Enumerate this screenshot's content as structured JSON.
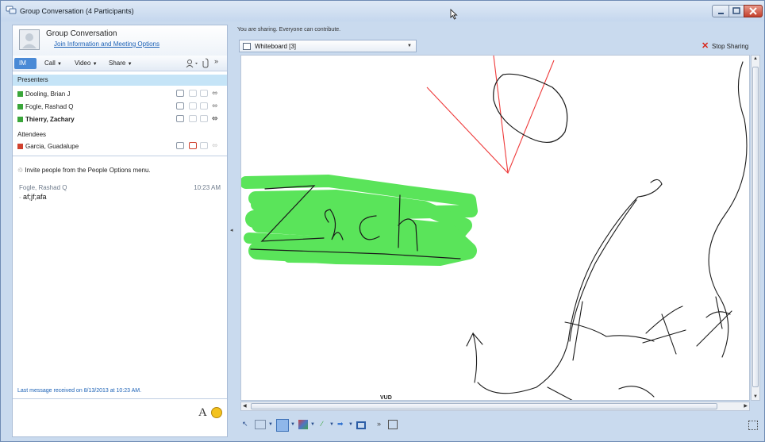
{
  "window": {
    "title": "Group Conversation (4 Participants)"
  },
  "contact": {
    "name": "Group Conversation",
    "link": "Join Information and Meeting Options"
  },
  "tabs": {
    "im": "IM",
    "call": "Call",
    "video": "Video",
    "share": "Share"
  },
  "participants": {
    "presenters_label": "Presenters",
    "attendees_label": "Attendees",
    "presenters": [
      {
        "name": "Dooling, Brian J",
        "status_color": "#3aa63a"
      },
      {
        "name": "Fogle, Rashad Q",
        "status_color": "#3aa63a"
      },
      {
        "name": "Thierry, Zachary",
        "status_color": "#3aa63a"
      }
    ],
    "attendees": [
      {
        "name": "Garcia, Guadalupe",
        "status_color": "#d0412e"
      }
    ]
  },
  "chat": {
    "invite_text": "Invite people from the People Options menu.",
    "author": "Fogle, Rashad Q",
    "time": "10:23 AM",
    "message": "af;jf;afa",
    "last_message": "Last message received on 8/13/2013 at 10:23 AM."
  },
  "compose": {
    "font_label": "A"
  },
  "sharing": {
    "status": "You are sharing. Everyone can contribute.",
    "selected": "Whiteboard [3]",
    "stop_label": "Stop Sharing"
  },
  "whiteboard": {
    "scroll_label": "VUD",
    "highlight_color": "#3ee03e",
    "ink_color": "#1a1a1a",
    "pen_red": "#ee3b3b"
  }
}
